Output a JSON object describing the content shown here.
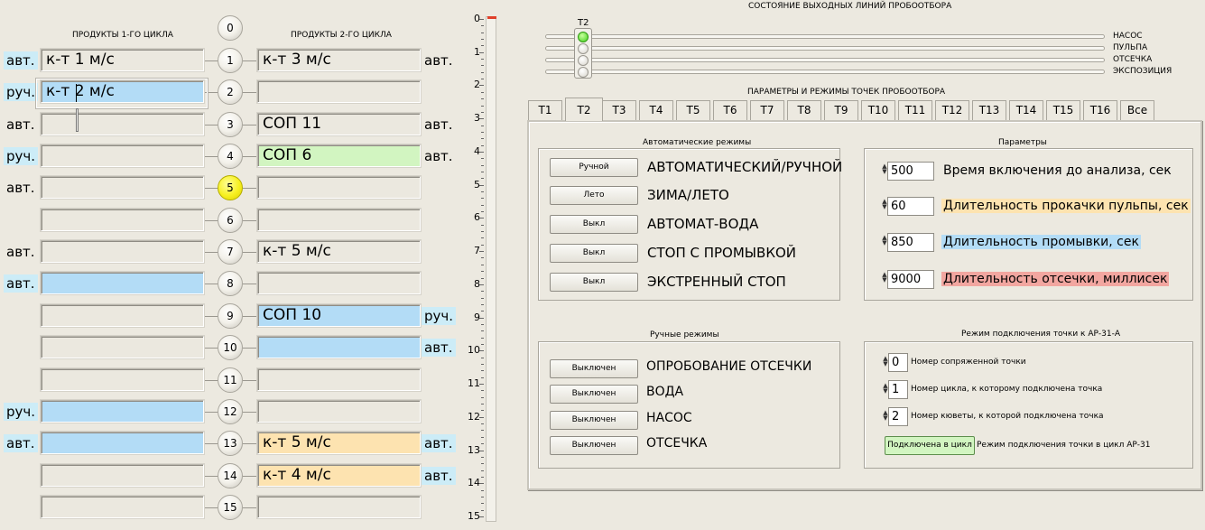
{
  "left": {
    "header1": "ПРОДУКТЫ 1-ГО ЦИКЛА",
    "header2": "ПРОДУКТЫ 2-ГО ЦИКЛА",
    "rows": [
      {
        "n": "0"
      },
      {
        "n": "1",
        "lmode": "авт.",
        "lval": "к-т 1 м/с",
        "rval": "к-т 3 м/с",
        "rmode": "авт."
      },
      {
        "n": "2",
        "lmode": "руч.",
        "lval": "к-т 2 м/с",
        "rval": "",
        "rmode": ""
      },
      {
        "n": "3",
        "lmode": "авт.",
        "lval": "",
        "rval": "СОП 11",
        "rmode": "авт."
      },
      {
        "n": "4",
        "lmode": "руч.",
        "lval": "",
        "rval": "СОП 6",
        "rmode": "авт."
      },
      {
        "n": "5",
        "lmode": "авт.",
        "lval": "",
        "rval": "",
        "rmode": ""
      },
      {
        "n": "6",
        "lmode": "",
        "lval": "",
        "rval": "",
        "rmode": ""
      },
      {
        "n": "7",
        "lmode": "авт.",
        "lval": "",
        "rval": "к-т 5 м/с",
        "rmode": ""
      },
      {
        "n": "8",
        "lmode": "авт.",
        "lval": "",
        "rval": "",
        "rmode": ""
      },
      {
        "n": "9",
        "lmode": "",
        "lval": "",
        "rval": "СОП 10",
        "rmode": "руч."
      },
      {
        "n": "10",
        "lmode": "",
        "lval": "",
        "rval": "",
        "rmode": "авт."
      },
      {
        "n": "11",
        "lmode": "",
        "lval": "",
        "rval": "",
        "rmode": ""
      },
      {
        "n": "12",
        "lmode": "руч.",
        "lval": "",
        "rval": "",
        "rmode": ""
      },
      {
        "n": "13",
        "lmode": "авт.",
        "lval": "",
        "rval": "к-т 5 м/с",
        "rmode": "авт."
      },
      {
        "n": "14",
        "lmode": "",
        "lval": "",
        "rval": "к-т 4 м/с",
        "rmode": "авт."
      },
      {
        "n": "15",
        "lmode": "",
        "lval": "",
        "rval": "",
        "rmode": ""
      }
    ]
  },
  "scale": [
    "0",
    "1",
    "2",
    "3",
    "4",
    "5",
    "6",
    "7",
    "8",
    "9",
    "10",
    "11",
    "12",
    "13",
    "14",
    "15"
  ],
  "status": {
    "title": "СОСТОЯНИЕ ВЫХОДНЫХ ЛИНИЙ ПРОБООТБОРА",
    "point": "Т2",
    "lines": [
      "НАСОС",
      "ПУЛЬПА",
      "ОТСЕЧКА",
      "ЭКСПОЗИЦИЯ"
    ]
  },
  "params_title": "ПАРАМЕТРЫ И РЕЖИМЫ ТОЧЕК ПРОБООТБОРА",
  "tabs": [
    "Т1",
    "Т2",
    "Т3",
    "Т4",
    "Т5",
    "Т6",
    "Т7",
    "Т8",
    "Т9",
    "Т10",
    "Т11",
    "Т12",
    "Т13",
    "Т14",
    "Т15",
    "Т16",
    "Все"
  ],
  "auto": {
    "title": "Автоматические режимы",
    "items": [
      {
        "btn": "Ручной",
        "label": "АВТОМАТИЧЕСКИЙ/РУЧНОЙ"
      },
      {
        "btn": "Лето",
        "label": "ЗИМА/ЛЕТО"
      },
      {
        "btn": "Выкл",
        "label": "АВТОМАТ-ВОДА"
      },
      {
        "btn": "Выкл",
        "label": "СТОП С ПРОМЫВКОЙ"
      },
      {
        "btn": "Выкл",
        "label": "ЭКСТРЕННЫЙ СТОП"
      }
    ]
  },
  "params": {
    "title": "Параметры",
    "items": [
      {
        "value": "500",
        "label": "Время включения до анализа, сек"
      },
      {
        "value": "60",
        "label": "Длительность прокачки пульпы, сек"
      },
      {
        "value": "850",
        "label": "Длительность промывки, сек"
      },
      {
        "value": "9000",
        "label": "Длительность отсечки, миллисек"
      }
    ]
  },
  "manual": {
    "title": "Ручные режимы",
    "items": [
      {
        "btn": "Выключен",
        "label": "ОПРОБОВАНИЕ ОТСЕЧКИ"
      },
      {
        "btn": "Выключен",
        "label": "ВОДА"
      },
      {
        "btn": "Выключен",
        "label": "НАСОС"
      },
      {
        "btn": "Выключен",
        "label": "ОТСЕЧКА"
      }
    ]
  },
  "connect": {
    "title": "Режим подключения точки к АР-31-А",
    "items": [
      {
        "value": "0",
        "label": "Номер сопряженной точки"
      },
      {
        "value": "1",
        "label": "Номер цикла, к которому подключена точка"
      },
      {
        "value": "2",
        "label": "Номер кюветы, к которой подключена точка"
      }
    ],
    "btn": "Подключена в цикл",
    "btn_label": "Режим подключения точки в цикл АР-31"
  }
}
